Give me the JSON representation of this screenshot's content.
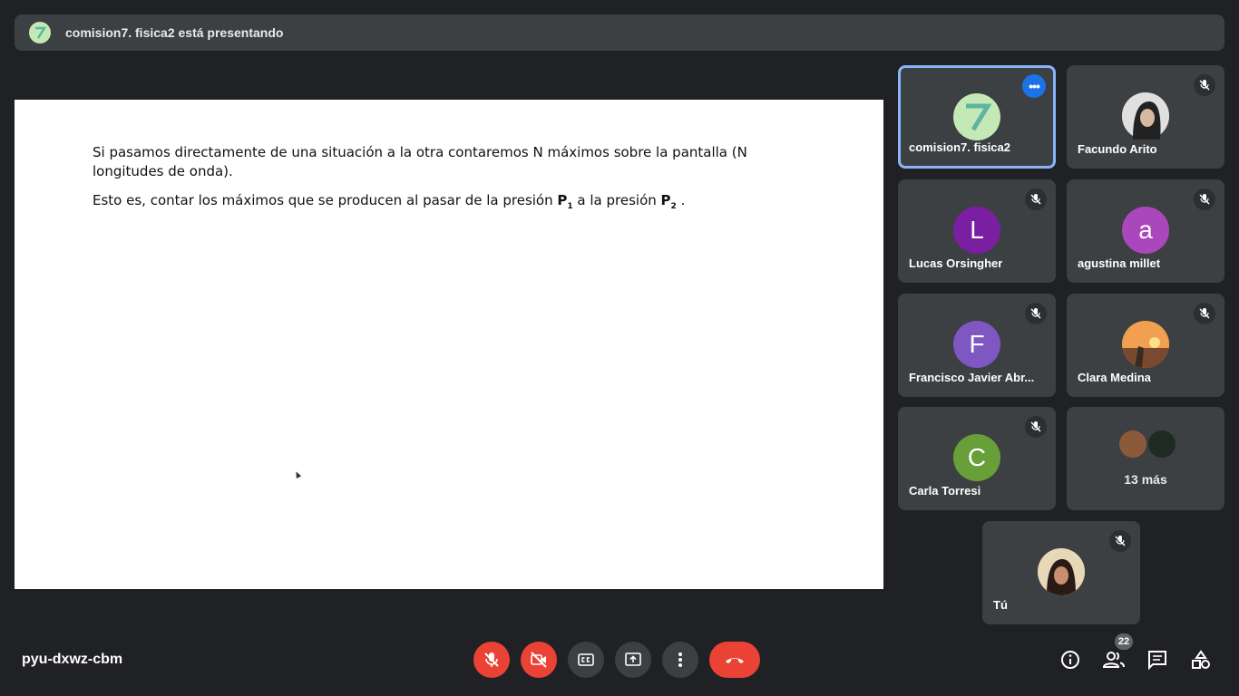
{
  "banner": {
    "presenting_text": "comision7. fisica2 está presentando"
  },
  "slide": {
    "paragraph1": "Si pasamos directamente de una situación a la otra contaremos N máximos sobre la pantalla (N longitudes de onda).",
    "paragraph2_prefix": "Esto es, contar los máximos que se producen al pasar de la presión ",
    "p1_letter": "P",
    "p1_sub": "1",
    "paragraph2_middle": " a la presión ",
    "p2_letter": "P",
    "p2_sub": "2",
    "paragraph2_suffix": " ."
  },
  "participants": [
    {
      "name": "comision7. fisica2",
      "avatar_color": "#c5e8b7",
      "active": true
    },
    {
      "name": "Facundo Arito",
      "avatar_color": "#d0d0d0"
    },
    {
      "name": "Lucas Orsingher",
      "initial": "L",
      "avatar_color": "#7b1fa2"
    },
    {
      "name": "agustina millet",
      "initial": "a",
      "avatar_color": "#ab47bc"
    },
    {
      "name": "Francisco Javier Abr...",
      "initial": "F",
      "avatar_color": "#7e57c2"
    },
    {
      "name": "Clara Medina",
      "avatar_color": "#e07b39"
    },
    {
      "name": "Carla Torresi",
      "initial": "C",
      "avatar_color": "#689f38"
    },
    {
      "more_label": "13 más"
    },
    {
      "name": "Tú",
      "avatar_color": "#c9a27a"
    }
  ],
  "bottombar": {
    "meeting_code": "pyu-dxwz-cbm",
    "participant_count": "22"
  },
  "colors": {
    "accent": "#1a73e8",
    "danger": "#ea4335",
    "tile": "#3c4043",
    "background": "#202124"
  }
}
